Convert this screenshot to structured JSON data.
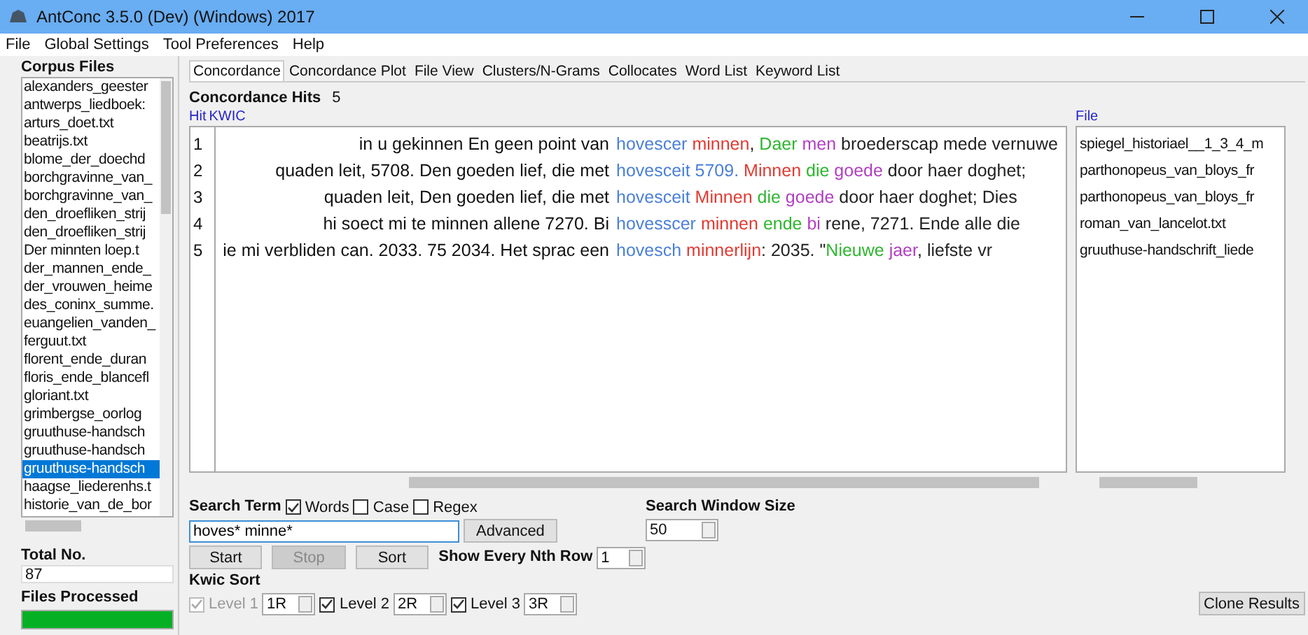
{
  "window": {
    "title": "AntConc 3.5.0 (Dev) (Windows) 2017"
  },
  "menu": [
    "File",
    "Global Settings",
    "Tool Preferences",
    "Help"
  ],
  "corpus_files": {
    "heading": "Corpus Files",
    "items": [
      {
        "label": "alexanders_geester",
        "selected": false
      },
      {
        "label": "antwerps_liedboek:",
        "selected": false
      },
      {
        "label": "arturs_doet.txt",
        "selected": false
      },
      {
        "label": "beatrijs.txt",
        "selected": false
      },
      {
        "label": "blome_der_doechd",
        "selected": false
      },
      {
        "label": "borchgravinne_van_",
        "selected": false
      },
      {
        "label": "borchgravinne_van_",
        "selected": false
      },
      {
        "label": "den_droefliken_strij",
        "selected": false
      },
      {
        "label": "den_droefliken_strij",
        "selected": false
      },
      {
        "label": "Der minnten loep.t",
        "selected": false
      },
      {
        "label": "der_mannen_ende_",
        "selected": false
      },
      {
        "label": "der_vrouwen_heime",
        "selected": false
      },
      {
        "label": "des_coninx_summe.",
        "selected": false
      },
      {
        "label": "euangelien_vanden_",
        "selected": false
      },
      {
        "label": "ferguut.txt",
        "selected": false
      },
      {
        "label": "florent_ende_duran",
        "selected": false
      },
      {
        "label": "floris_ende_blancefl",
        "selected": false
      },
      {
        "label": "gloriant.txt",
        "selected": false
      },
      {
        "label": "grimbergse_oorlog",
        "selected": false
      },
      {
        "label": "gruuthuse-handsch",
        "selected": false
      },
      {
        "label": "gruuthuse-handsch",
        "selected": false
      },
      {
        "label": "gruuthuse-handsch",
        "selected": true
      },
      {
        "label": "haagse_liederenhs.t",
        "selected": false
      },
      {
        "label": "historie_van_de_bor",
        "selected": false
      }
    ]
  },
  "total": {
    "label": "Total No.",
    "value": "87"
  },
  "files_processed": {
    "label": "Files Processed",
    "level": 1
  },
  "tabs": [
    {
      "label": "Concordance",
      "selected": true
    },
    {
      "label": "Concordance Plot",
      "selected": false
    },
    {
      "label": "File View",
      "selected": false
    },
    {
      "label": "Clusters/N-Grams",
      "selected": false
    },
    {
      "label": "Collocates",
      "selected": false
    },
    {
      "label": "Word List",
      "selected": false
    },
    {
      "label": "Keyword List",
      "selected": false
    }
  ],
  "concordance": {
    "hits_label": "Concordance Hits",
    "hits": "5",
    "columns": [
      "Hit",
      "KWIC",
      "File"
    ],
    "rows": [
      {
        "hit": "1",
        "left": "in u gekinnen En geen point van",
        "right": [
          {
            "text": "hovescer",
            "color": "#4a7fd8"
          },
          {
            "text": " minnen",
            "color": "#e03a32"
          },
          {
            "text": ", ",
            "color": "#222222"
          },
          {
            "text": "Daer",
            "color": "#2fb52f"
          },
          {
            "text": " men",
            "color": "#b040c0"
          },
          {
            "text": " broederscap mede vernuwe",
            "color": "#222222"
          }
        ],
        "file": "spiegel_historiael__1_3_4_m"
      },
      {
        "hit": "2",
        "left": "quaden leit, 5708. Den goeden lief, die met",
        "right": [
          {
            "text": "hovesceit 5709.",
            "color": "#4a7fd8"
          },
          {
            "text": " Minnen",
            "color": "#e03a32"
          },
          {
            "text": " die",
            "color": "#2fb52f"
          },
          {
            "text": " goede",
            "color": "#b040c0"
          },
          {
            "text": " door haer doghet;",
            "color": "#222222"
          }
        ],
        "file": "parthonopeus_van_bloys_fr"
      },
      {
        "hit": "3",
        "left": "quaden leit, Den goeden lief, die met",
        "right": [
          {
            "text": "hovesceit",
            "color": "#4a7fd8"
          },
          {
            "text": " Minnen",
            "color": "#e03a32"
          },
          {
            "text": " die",
            "color": "#2fb52f"
          },
          {
            "text": " goede",
            "color": "#b040c0"
          },
          {
            "text": " door haer doghet; Dies",
            "color": "#222222"
          }
        ],
        "file": "parthonopeus_van_bloys_fr"
      },
      {
        "hit": "4",
        "left": "hi soect mi te minnen allene 7270. Bi",
        "right": [
          {
            "text": "hovesscer",
            "color": "#4a7fd8"
          },
          {
            "text": " minnen",
            "color": "#e03a32"
          },
          {
            "text": " ende",
            "color": "#2fb52f"
          },
          {
            "text": " bi",
            "color": "#b040c0"
          },
          {
            "text": " rene, 7271. Ende alle die",
            "color": "#222222"
          }
        ],
        "file": "roman_van_lancelot.txt"
      },
      {
        "hit": "5",
        "left": "ie mi verbliden can. 2033. 75 2034. Het sprac een",
        "right": [
          {
            "text": "hovesch",
            "color": "#4a7fd8"
          },
          {
            "text": " minnerlijn",
            "color": "#e03a32"
          },
          {
            "text": ": 2035. \"",
            "color": "#222222"
          },
          {
            "text": "Nieuwe",
            "color": "#2fb52f"
          },
          {
            "text": " jaer",
            "color": "#b040c0"
          },
          {
            "text": ", liefste vr",
            "color": "#222222"
          }
        ],
        "file": "gruuthuse-handschrift_liede"
      }
    ]
  },
  "search": {
    "label": "Search Term",
    "options": [
      {
        "label": "Words",
        "checked": true
      },
      {
        "label": "Case",
        "checked": false
      },
      {
        "label": "Regex",
        "checked": false
      }
    ],
    "value": "hoves* minne*",
    "advanced": "Advanced",
    "window_size_label": "Search Window Size",
    "window_size": "50"
  },
  "buttons": [
    {
      "label": "Start",
      "disabled": false
    },
    {
      "label": "Stop",
      "disabled": true
    },
    {
      "label": "Sort",
      "disabled": false
    }
  ],
  "nth_row": {
    "label": "Show Every Nth Row",
    "value": "1"
  },
  "kwic_sort": {
    "label": "Kwic Sort",
    "levels": [
      {
        "label": "Level 1",
        "value": "1R",
        "checked": true,
        "disabled": true
      },
      {
        "label": "Level 2",
        "value": "2R",
        "checked": true,
        "disabled": false
      },
      {
        "label": "Level 3",
        "value": "3R",
        "checked": true,
        "disabled": false
      }
    ]
  },
  "clone": "Clone Results"
}
